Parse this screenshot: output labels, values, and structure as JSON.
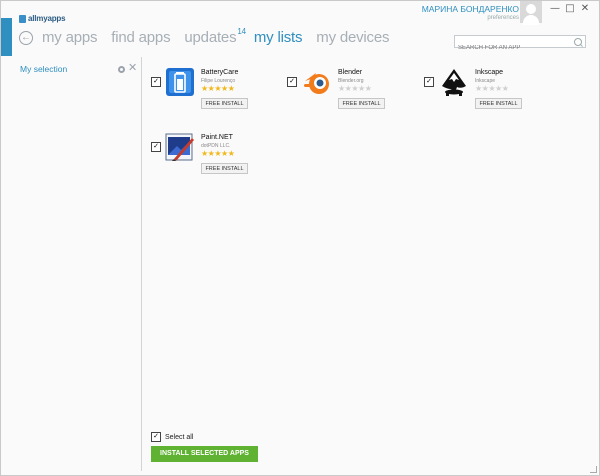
{
  "app": {
    "logo_text": "allmyapps"
  },
  "user": {
    "name": "МАРИНА БОНДАРЕНКО",
    "preferences_label": "preferences"
  },
  "window_controls": [
    "—",
    "□",
    "✕"
  ],
  "nav": {
    "items": [
      {
        "label": "my apps",
        "active": false,
        "badge": ""
      },
      {
        "label": "find apps",
        "active": false,
        "badge": ""
      },
      {
        "label": "updates",
        "active": false,
        "badge": "14"
      },
      {
        "label": "my lists",
        "active": true,
        "badge": ""
      },
      {
        "label": "my devices",
        "active": false,
        "badge": ""
      }
    ],
    "search_placeholder": "SEARCH FOR AN APP"
  },
  "sidebar": {
    "items": [
      {
        "label": "My selection"
      }
    ]
  },
  "apps": [
    {
      "name": "BatteryCare",
      "vendor": "Filipe Lourenço",
      "stars": 5,
      "button": "FREE INSTALL",
      "checked": true
    },
    {
      "name": "Blender",
      "vendor": "Blender.org",
      "stars": 0,
      "button": "FREE INSTALL",
      "checked": true
    },
    {
      "name": "Inkscape",
      "vendor": "Inkscape",
      "stars": 0,
      "button": "FREE INSTALL",
      "checked": true
    },
    {
      "name": "Paint.NET",
      "vendor": "dotPDN LLC.",
      "stars": 5,
      "button": "FREE INSTALL",
      "checked": true
    }
  ],
  "footer": {
    "select_all_label": "Select all",
    "select_all_checked": true,
    "install_selected_label": "INSTALL SELECTED APPS"
  },
  "colors": {
    "accent": "#2f8fc0",
    "install_green": "#5fb232",
    "star_on": "#f1b81b",
    "star_off": "#cfcfcf"
  }
}
